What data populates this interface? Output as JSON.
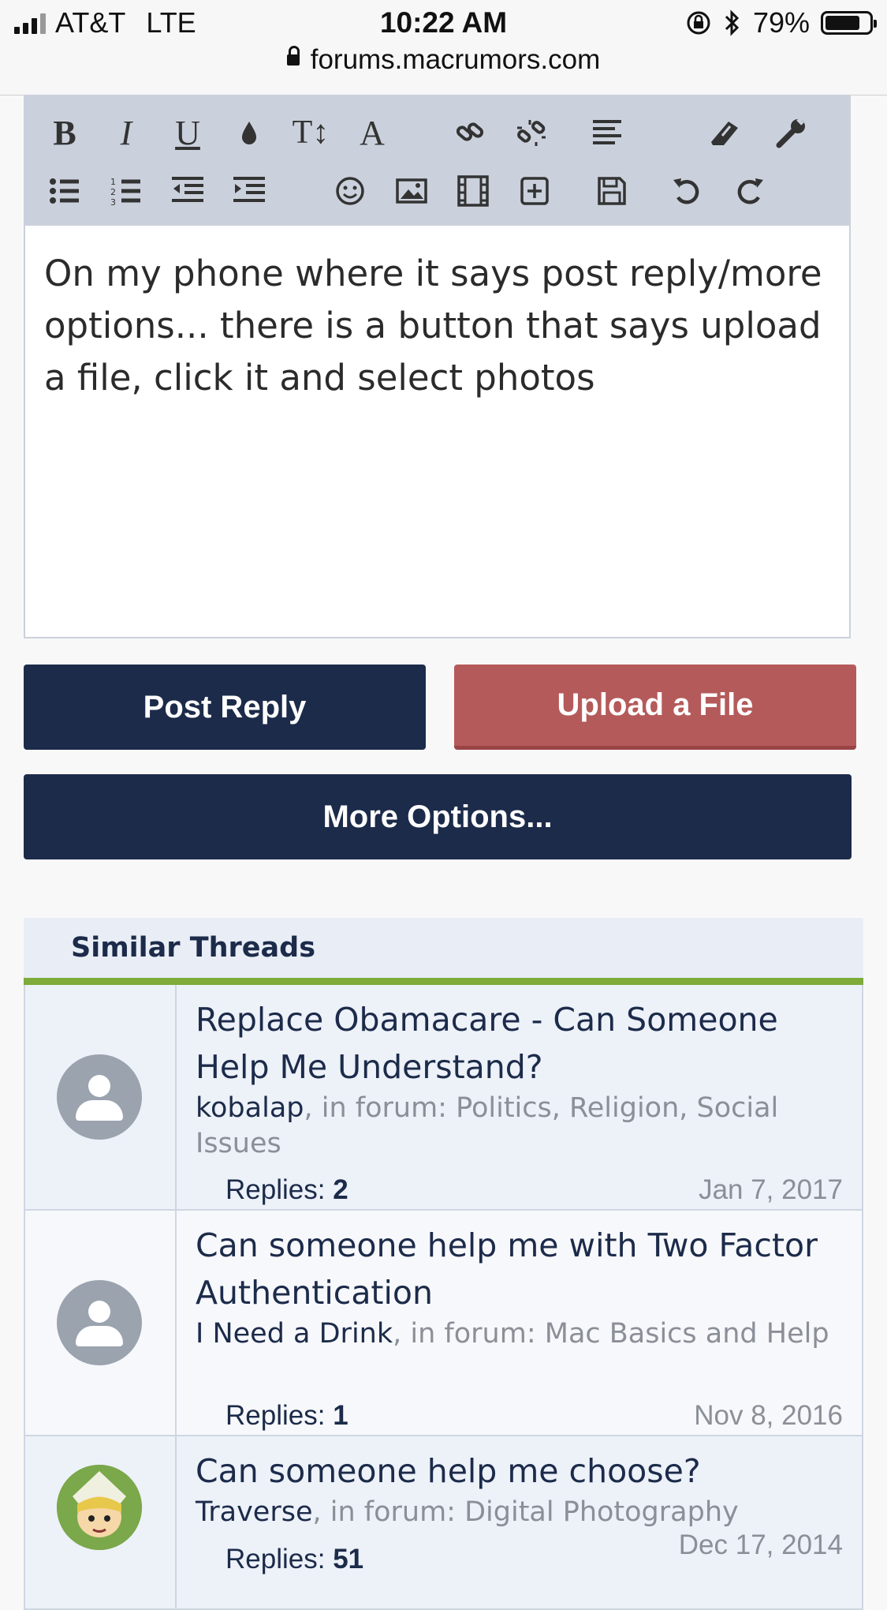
{
  "status_bar": {
    "carrier": "AT&T",
    "network": "LTE",
    "time": "10:22 AM",
    "battery_percent": "79%",
    "battery_level": 0.79
  },
  "browser": {
    "url": "forums.macrumors.com"
  },
  "editor": {
    "toolbar_row1": [
      "bold-icon",
      "italic-icon",
      "underline-icon",
      "text-color-icon",
      "font-size-icon",
      "font-family-icon",
      "link-icon",
      "unlink-icon",
      "align-icon",
      "eraser-icon",
      "wrench-icon"
    ],
    "toolbar_row2": [
      "bullet-list-icon",
      "numbered-list-icon",
      "outdent-icon",
      "indent-icon",
      "smiley-icon",
      "image-icon",
      "media-icon",
      "insert-icon",
      "save-draft-icon",
      "undo-icon",
      "redo-icon"
    ],
    "text": "On my phone where it says post reply/more options... there is a button that says upload a file, click it and select photos"
  },
  "actions": {
    "post_reply": "Post Reply",
    "upload_file": "Upload a File",
    "more_options": "More Options..."
  },
  "similar_threads": {
    "heading": "Similar Threads",
    "threads": [
      {
        "title": "Replace Obamacare - Can Someone Help Me Understand?",
        "author": "kobalap",
        "forum_text": ", in forum: Politics, Religion, Social Issues",
        "replies_label": "Replies:",
        "replies": "2",
        "date": "Jan 7, 2017",
        "avatar": "default-avatar-icon"
      },
      {
        "title": "Can someone help me with Two Factor Authentication",
        "author": "I Need a Drink",
        "forum_text": ", in forum: Mac Basics and Help",
        "replies_label": "Replies:",
        "replies": "1",
        "date": "Nov 8, 2016",
        "avatar": "default-avatar-icon"
      },
      {
        "title": "Can someone help me choose?",
        "author": "Traverse",
        "forum_text": ", in forum: Digital Photography",
        "replies_label": "Replies:",
        "replies": "51",
        "date": "Dec 17, 2014",
        "avatar": "cartoon-avatar-icon"
      }
    ]
  },
  "colors": {
    "navy": "#1c2b4a",
    "upload_red": "#b55a5a",
    "accent_green": "#7eab3a",
    "toolbar_bg": "#cbd1dc"
  }
}
